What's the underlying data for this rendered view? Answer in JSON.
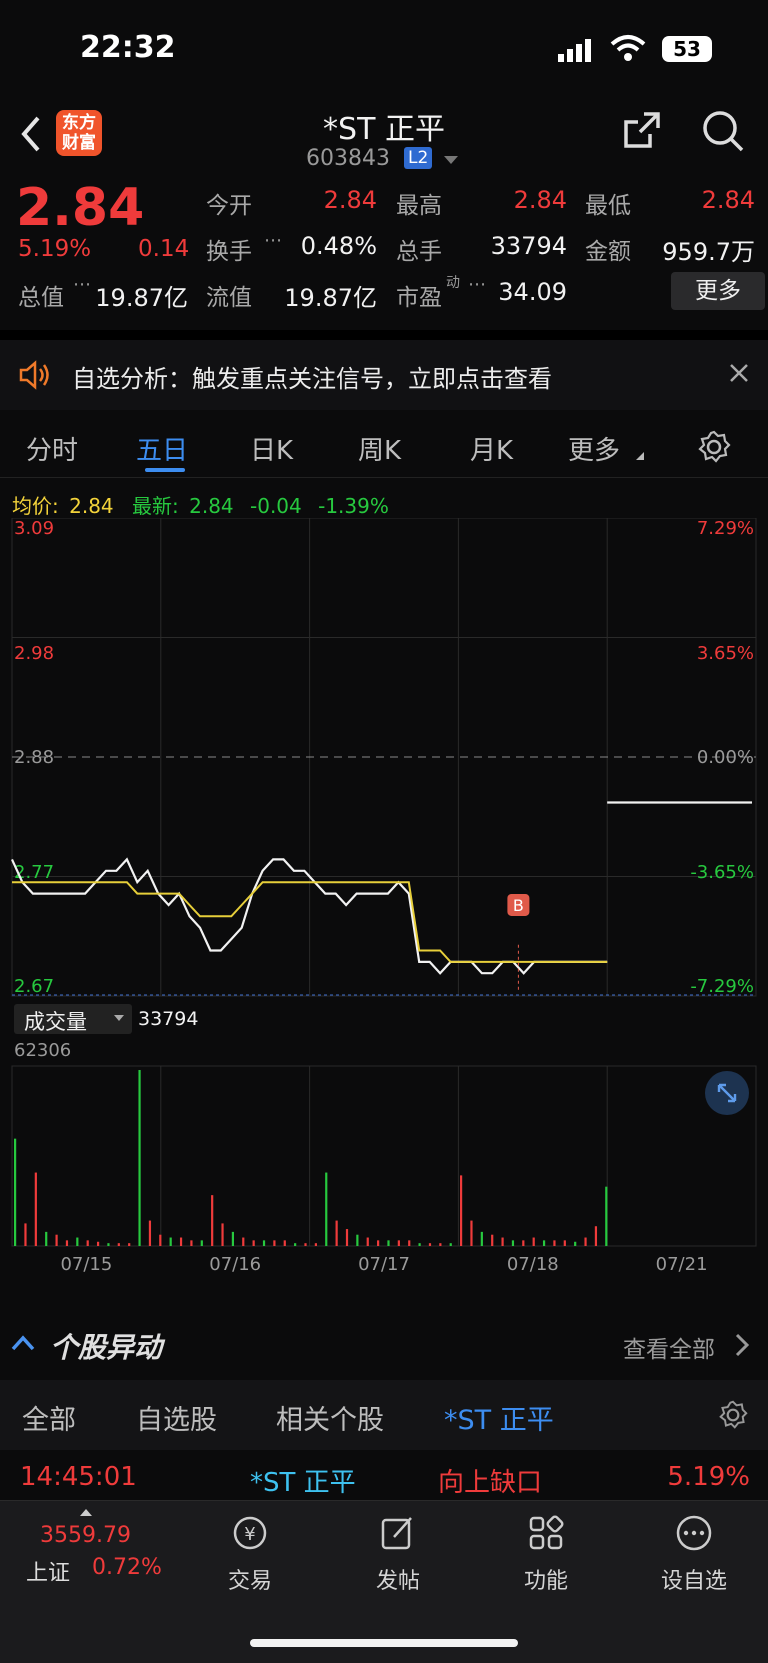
{
  "status": {
    "time": "22:32",
    "battery": "53"
  },
  "header": {
    "logo_line1": "东方",
    "logo_line2": "财富",
    "title": "*ST 正平",
    "code": "603843",
    "level_badge": "L2"
  },
  "quote": {
    "price": "2.84",
    "change_pct": "5.19%",
    "change_amt": "0.14",
    "open_label": "今开",
    "open": "2.84",
    "high_label": "最高",
    "high": "2.84",
    "low_label": "最低",
    "low": "2.84",
    "turnover_label": "换手",
    "turnover": "0.48%",
    "volume_label": "总手",
    "volume": "33794",
    "amount_label": "金额",
    "amount": "959.7万",
    "mktcap_label": "总值",
    "mktcap": "19.87亿",
    "float_label": "流值",
    "float_cap": "19.87亿",
    "pe_label": "市盈",
    "pe_sup": "动",
    "pe": "34.09",
    "more_button": "更多"
  },
  "alert": {
    "text": "自选分析：触发重点关注信号，立即点击查看"
  },
  "tabs": [
    "分时",
    "五日",
    "日K",
    "周K",
    "月K",
    "更多"
  ],
  "active_tab": "五日",
  "chart_info": {
    "avg_label": "均价:",
    "avg": "2.84",
    "latest_label": "最新:",
    "latest": "2.84",
    "change": "-0.04",
    "change_pct": "-1.39%",
    "marker": "B",
    "volume_label": "成交量",
    "volume_value": "33794",
    "volume_max": "62306"
  },
  "chart_data": {
    "type": "line",
    "title": "",
    "y_left_ticks": [
      "3.09",
      "2.98",
      "2.88",
      "2.77",
      "2.67"
    ],
    "y_right_ticks": [
      "7.29%",
      "3.65%",
      "0.00%",
      "-3.65%",
      "-7.29%"
    ],
    "prev_close": 2.88,
    "ylim": [
      2.67,
      3.09
    ],
    "x_labels": [
      "07/15",
      "07/16",
      "07/17",
      "07/18",
      "07/21"
    ],
    "series": [
      {
        "name": "",
        "values": [
          2.79,
          2.77,
          2.76,
          2.76,
          2.76,
          2.76,
          2.76,
          2.76,
          2.77,
          2.78,
          2.78,
          2.79,
          2.77,
          2.78,
          2.76,
          2.75,
          2.76,
          2.74,
          2.73,
          2.71,
          2.71,
          2.72,
          2.73,
          2.76,
          2.78,
          2.79,
          2.79,
          2.78,
          2.78,
          2.77,
          2.76,
          2.76,
          2.75,
          2.76,
          2.76,
          2.76,
          2.76,
          2.77,
          2.76,
          2.7,
          2.7,
          2.69,
          2.7,
          2.7,
          2.7,
          2.69,
          2.69,
          2.7,
          2.7,
          2.69,
          2.7,
          2.7,
          2.7,
          2.7,
          2.7,
          2.7,
          2.7,
          2.7
        ]
      },
      {
        "name": "",
        "values": [
          2.77,
          2.77,
          2.77,
          2.77,
          2.77,
          2.77,
          2.77,
          2.77,
          2.77,
          2.77,
          2.77,
          2.77,
          2.76,
          2.76,
          2.76,
          2.76,
          2.76,
          2.75,
          2.74,
          2.74,
          2.74,
          2.74,
          2.75,
          2.76,
          2.77,
          2.77,
          2.77,
          2.77,
          2.77,
          2.77,
          2.77,
          2.77,
          2.77,
          2.77,
          2.77,
          2.77,
          2.77,
          2.77,
          2.77,
          2.71,
          2.71,
          2.71,
          2.7,
          2.7,
          2.7,
          2.7,
          2.7,
          2.7,
          2.7,
          2.7,
          2.7,
          2.7,
          2.7,
          2.7,
          2.7,
          2.7,
          2.7,
          2.7
        ]
      }
    ],
    "last_day_level": 2.84,
    "volume_values": [
      38000,
      8000,
      26000,
      5000,
      4000,
      2000,
      3000,
      2000,
      1500,
      1000,
      1000,
      1000,
      62306,
      9000,
      4000,
      3000,
      3000,
      2000,
      2000,
      18000,
      8000,
      5000,
      3000,
      2000,
      2000,
      2000,
      2000,
      1000,
      1000,
      1000,
      26000,
      9000,
      6000,
      4000,
      3000,
      2000,
      2000,
      2000,
      2000,
      1000,
      1000,
      1000,
      1000,
      25000,
      9000,
      5000,
      4000,
      3000,
      2000,
      2000,
      3000,
      2000,
      2000,
      2000,
      1500,
      3000,
      7000,
      21000
    ],
    "grid": true
  },
  "news": {
    "section_title": "个股异动",
    "view_all": "查看全部",
    "filters": [
      "全部",
      "自选股",
      "相关个股",
      "*ST 正平"
    ],
    "active_filter": "*ST 正平",
    "row": {
      "time": "14:45:01",
      "name": "*ST 正平",
      "event": "向上缺口",
      "pct": "5.19%"
    }
  },
  "bottom_nav": {
    "index_value": "3559.79",
    "index_name": "上证",
    "index_pct": "0.72%",
    "items": [
      "交易",
      "发帖",
      "功能",
      "设自选"
    ]
  },
  "colors": {
    "up": "#ef3b3b",
    "down": "#27c93f",
    "accent": "#3d8df0",
    "avg_line": "#e7cf3a"
  }
}
